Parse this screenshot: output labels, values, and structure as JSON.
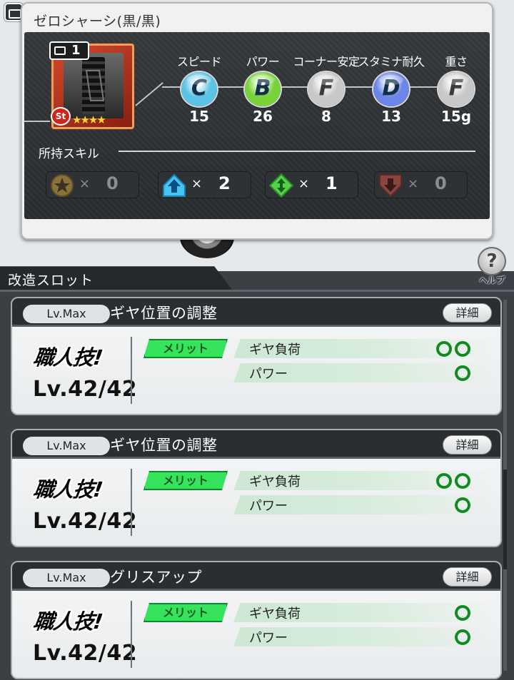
{
  "part": {
    "name": "ゼロシャーシ(黒/黒)",
    "box_count": "1",
    "type_badge": "St",
    "stars": "★★★★"
  },
  "stats": [
    {
      "label": "スピード",
      "grade": "C",
      "value": "15",
      "color": "#5bc3e6"
    },
    {
      "label": "パワー",
      "grade": "B",
      "value": "26",
      "color": "#78d23a"
    },
    {
      "label": "コーナー安定",
      "grade": "F",
      "value": "8",
      "color": "#c8c8c8"
    },
    {
      "label": "スタミナ耐久",
      "grade": "D",
      "value": "13",
      "color": "#6b86e8"
    },
    {
      "label": "重さ",
      "grade": "F",
      "value": "15g",
      "color": "#c8c8c8"
    }
  ],
  "skills": {
    "label": "所持スキル",
    "items": [
      {
        "icon": "star-medal-icon",
        "times": "×",
        "count": "0"
      },
      {
        "icon": "arrow-up-icon",
        "times": "×",
        "count": "2"
      },
      {
        "icon": "arrow-updown-icon",
        "times": "×",
        "count": "1"
      },
      {
        "icon": "arrow-down-icon",
        "times": "×",
        "count": "0"
      }
    ]
  },
  "slot_header": "改造スロット",
  "help_label": "ヘルプ",
  "slots": [
    {
      "level_tag": "Lv.Max",
      "name": "ギヤ位置の調整",
      "detail": "詳細",
      "craft_label": "職人技!",
      "craft_level": "Lv.42/42",
      "merit": "メリット",
      "effects": [
        {
          "label": "ギヤ負荷",
          "grade": "○○",
          "rings": 2
        },
        {
          "label": "パワー",
          "grade": "○",
          "rings": 1
        }
      ]
    },
    {
      "level_tag": "Lv.Max",
      "name": "ギヤ位置の調整",
      "detail": "詳細",
      "craft_label": "職人技!",
      "craft_level": "Lv.42/42",
      "merit": "メリット",
      "effects": [
        {
          "label": "ギヤ負荷",
          "grade": "○○",
          "rings": 2
        },
        {
          "label": "パワー",
          "grade": "○",
          "rings": 1
        }
      ]
    },
    {
      "level_tag": "Lv.Max",
      "name": "グリスアップ",
      "detail": "詳細",
      "craft_label": "職人技!",
      "craft_level": "Lv.42/42",
      "merit": "メリット",
      "effects": [
        {
          "label": "ギヤ負荷",
          "grade": "○",
          "rings": 1
        },
        {
          "label": "パワー",
          "grade": "○",
          "rings": 1
        }
      ]
    }
  ],
  "colors": {
    "merit_green": "#35e35c",
    "grade_ring": "#128a22",
    "card_header": "#2b2e31"
  }
}
